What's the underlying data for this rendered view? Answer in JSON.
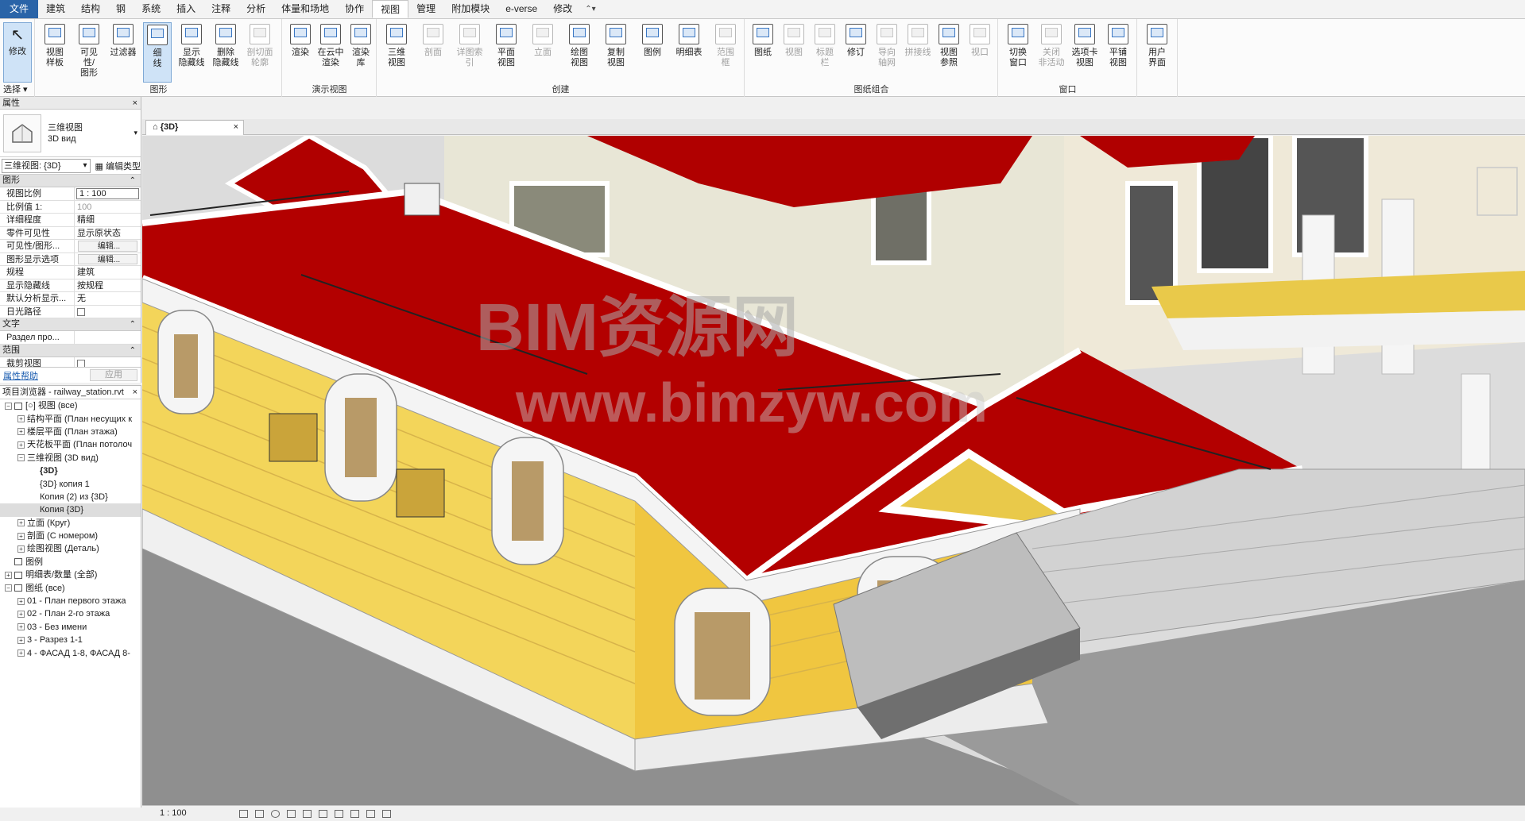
{
  "tabs": [
    "文件",
    "建筑",
    "结构",
    "钢",
    "系统",
    "插入",
    "注释",
    "分析",
    "体量和场地",
    "协作",
    "视图",
    "管理",
    "附加模块",
    "e-verse",
    "修改",
    "⌃▾"
  ],
  "active_tab": "视图",
  "ribbon": {
    "select": {
      "modify": "修改",
      "panel_label": "选择 ▾"
    },
    "graphics": {
      "title": "图形",
      "buttons": [
        "视图\n样板",
        "可见性/\n图形",
        "过滤器",
        "细\n线",
        "显示\n隐藏线",
        "删除\n隐藏线",
        "剖切面\n轮廓"
      ]
    },
    "presentation": {
      "title": "演示视图",
      "buttons": [
        "渲染",
        "在云中\n渲染",
        "渲染\n库"
      ]
    },
    "create": {
      "title": "创建",
      "buttons": [
        "三维\n视图",
        "剖面",
        "详图索引",
        "平面\n视图",
        "立面",
        "绘图\n视图",
        "复制\n视图",
        "图例",
        "明细表",
        "范围\n框"
      ]
    },
    "sheet": {
      "title": "图纸组合",
      "buttons": [
        "图纸",
        "视图",
        "标题\n栏",
        "修订",
        "导向\n轴网",
        "拼接线",
        "视图\n参照",
        "视口"
      ]
    },
    "windows": {
      "title": "窗口",
      "buttons": [
        "切换\n窗口",
        "关闭\n非活动",
        "选项卡\n视图",
        "平铺\n视图"
      ]
    },
    "ui": {
      "buttons": [
        "用户\n界面"
      ]
    }
  },
  "properties": {
    "title": "属性",
    "type_name_cn": "三维视图",
    "type_name_ru": "3D вид",
    "view_selector": "三维视图: {3D}",
    "edit_type": "编辑类型",
    "sections": {
      "graphics": "图形",
      "text": "文字",
      "extents": "范围"
    },
    "graphics_rows": [
      {
        "k": "视图比例",
        "v": "1 : 100"
      },
      {
        "k": "比例值 1:",
        "v": "100"
      },
      {
        "k": "详细程度",
        "v": "精细"
      },
      {
        "k": "零件可见性",
        "v": "显示原状态"
      },
      {
        "k": "可见性/图形...",
        "v": "编辑..."
      },
      {
        "k": "图形显示选项",
        "v": "编辑..."
      },
      {
        "k": "规程",
        "v": "建筑"
      },
      {
        "k": "显示隐藏线",
        "v": "按规程"
      },
      {
        "k": "默认分析显示...",
        "v": "无"
      },
      {
        "k": "日光路径",
        "v": ""
      }
    ],
    "text_rows": [
      {
        "k": "Раздел про...",
        "v": ""
      }
    ],
    "extents_rows": [
      {
        "k": "裁剪视图",
        "v": ""
      }
    ],
    "help": "属性帮助",
    "apply": "应用"
  },
  "browser": {
    "title": "项目浏览器 - railway_station.rvt",
    "items": [
      {
        "t": "[○] 视图 (все)",
        "lvl": 0,
        "tog": "−"
      },
      {
        "t": "结构平面 (План несущих к",
        "lvl": 1,
        "tog": "+"
      },
      {
        "t": "楼层平面 (План этажа)",
        "lvl": 1,
        "tog": "+"
      },
      {
        "t": "天花板平面 (План потолоч",
        "lvl": 1,
        "tog": "+"
      },
      {
        "t": "三维视图 (3D вид)",
        "lvl": 1,
        "tog": "−"
      },
      {
        "t": "{3D}",
        "lvl": 2,
        "tog": "",
        "bold": true
      },
      {
        "t": "{3D} копия 1",
        "lvl": 2,
        "tog": ""
      },
      {
        "t": "Копия (2) из {3D}",
        "lvl": 2,
        "tog": ""
      },
      {
        "t": "Копия {3D}",
        "lvl": 2,
        "tog": "",
        "hl": true
      },
      {
        "t": "立面 (Круг)",
        "lvl": 1,
        "tog": "+"
      },
      {
        "t": "剖面 (С номером)",
        "lvl": 1,
        "tog": "+"
      },
      {
        "t": "绘图视图 (Деталь)",
        "lvl": 1,
        "tog": "+"
      },
      {
        "t": "图例",
        "lvl": 0,
        "tog": ""
      },
      {
        "t": "明细表/数量 (全部)",
        "lvl": 0,
        "tog": "+"
      },
      {
        "t": "图纸 (все)",
        "lvl": 0,
        "tog": "−"
      },
      {
        "t": "01 - План первого этажа",
        "lvl": 1,
        "tog": "+"
      },
      {
        "t": "02 - План 2-го этажа",
        "lvl": 1,
        "tog": "+"
      },
      {
        "t": "03 - Без имени",
        "lvl": 1,
        "tog": "+"
      },
      {
        "t": "3 - Разрез 1-1",
        "lvl": 1,
        "tog": "+"
      },
      {
        "t": "4 - ФАСАД 1-8, ФАСАД 8-",
        "lvl": 1,
        "tog": "+"
      }
    ]
  },
  "view": {
    "tab_label": "{3D}",
    "scale": "1 : 100",
    "watermark_1": "BIM资源网",
    "watermark_2": "www.bimzyw.com"
  },
  "colors": {
    "roof": "#b10000",
    "wall_yellow": "#f3d75a",
    "trim_white": "#f4f4f4",
    "ground": "#8a8a8a"
  }
}
